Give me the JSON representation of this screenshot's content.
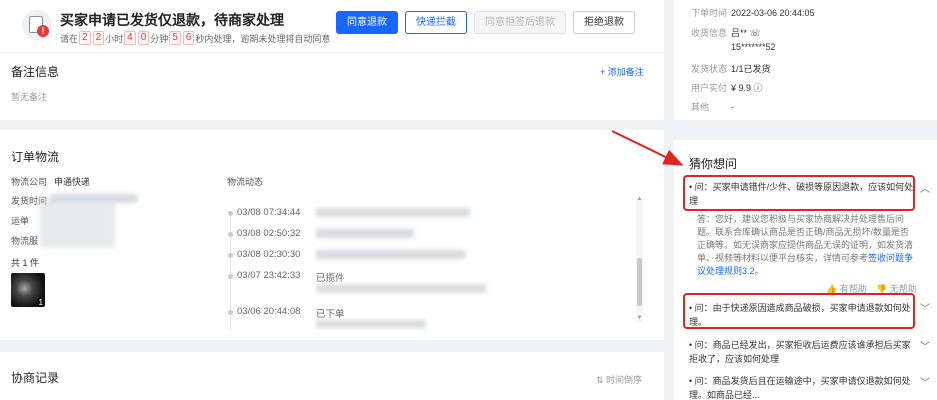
{
  "banner": {
    "badge": "!",
    "title": "买家申请已发货仅退款，待商家处理",
    "sub_prefix": "请在",
    "hours_digits": [
      "2",
      "2"
    ],
    "hours_unit": "小时",
    "minutes_digits": [
      "4",
      "0"
    ],
    "minutes_unit": "分钟",
    "seconds_digits": [
      "5",
      "6"
    ],
    "sub_suffix": "秒内处理，逾期未处理将自动同意",
    "buttons": {
      "agree": "同意退款",
      "intercept": "快递拦截",
      "reject_sign": "同意拒签后退款",
      "refuse": "拒绝退款"
    }
  },
  "remarks": {
    "title": "备注信息",
    "add_label": "+ 添加备注",
    "empty_text": "暂无备注"
  },
  "logistics": {
    "title": "订单物流",
    "company_label": "物流公司",
    "company_value": "申通快递",
    "ship_time_label": "发货时间",
    "waybill_label": "运单",
    "logistics_label": "物流服",
    "count_label": "共 1 件",
    "product_qty": "1",
    "dynamics_label": "物流动态",
    "timeline": [
      {
        "date": "03/08 07:34:44",
        "text": ""
      },
      {
        "date": "03/08 02:50:32",
        "text": ""
      },
      {
        "date": "03/08 02:30:30",
        "text": ""
      },
      {
        "date": "03/07 23:42:33",
        "text": "已揽件"
      },
      {
        "date": "03/06 20:44:08",
        "text": "已下单"
      }
    ]
  },
  "negotiation": {
    "title": "协商记录",
    "sort_label": "⇅ 时间倒序"
  },
  "order_info": {
    "rows": [
      {
        "k": "下单时间",
        "v": "2022-03-06 20:44:05"
      },
      {
        "k": "收货信息",
        "v": "吕** ☏"
      },
      {
        "k": "",
        "v": "15*******52"
      },
      {
        "k": "发货状态",
        "v": "1/1已发货"
      },
      {
        "k": "用户实付",
        "v": "¥ 9.9 ⓘ"
      },
      {
        "k": "其他",
        "v": "-"
      }
    ]
  },
  "faq": {
    "title": "猜你想问",
    "items": [
      {
        "q": "• 问：买家申请错件/少件、破损等原因退款，应该如何处理",
        "expanded": true
      },
      {
        "q": "• 问：由于快递原因造成商品破损，买家申请退款如何处理。"
      },
      {
        "q": "• 问：商品已经发出，买家拒收后运费应该谁承担后买家拒收了，应该如何处理"
      },
      {
        "q": "• 问：商品发货后且在运输途中，买家申请仅退款如何处理。如商品已经..."
      }
    ],
    "answer_text": "答：您好，建议您积极与买家协商解决并处理售后问题。联系合库确认商品是否正确/商品无损坏/数量是否正确等。如无误商家应提供商品无误的证明，如发货清单、视频等材料以便平台核实，详情可参考",
    "answer_link": "签收问题争议处理规则3.2。",
    "helpful": "有帮助",
    "not_helpful": "无帮助"
  },
  "colors": {
    "primary": "#1966ff",
    "danger": "#e23c39",
    "highlight": "#e0251e"
  }
}
